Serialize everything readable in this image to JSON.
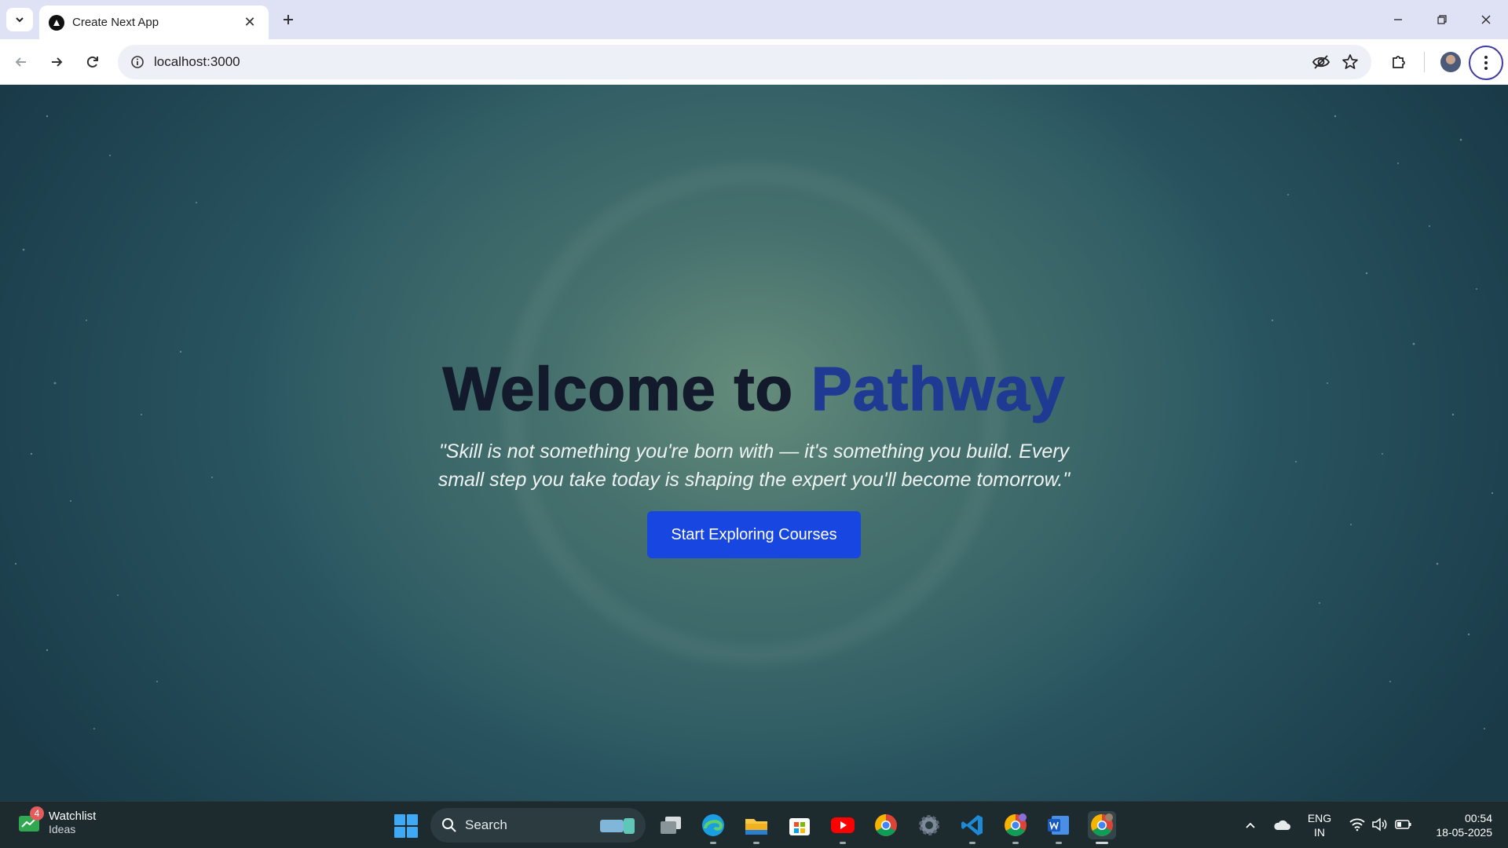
{
  "browser": {
    "tab": {
      "title": "Create Next App"
    },
    "address": {
      "url": "localhost:3000"
    }
  },
  "hero": {
    "title_part1": "Welcome to ",
    "title_part2": "Pathway",
    "quote_line1": "\"Skill is not something you're born with — it's something you build. Every",
    "quote_line2": "small step you take today is shaping the expert you'll become tomorrow.\"",
    "cta_label": "Start Exploring Courses"
  },
  "taskbar": {
    "widget": {
      "title": "Watchlist",
      "subtitle": "Ideas",
      "badge": "4"
    },
    "search_label": "Search",
    "lang_line1": "ENG",
    "lang_line2": "IN",
    "time": "00:54",
    "date": "18-05-2025",
    "apps": [
      "task-view",
      "edge",
      "file-explorer",
      "store",
      "youtube",
      "chrome",
      "settings",
      "vscode",
      "chrome-profile",
      "word",
      "chrome-active"
    ]
  },
  "colors": {
    "accent_title": "#1f3a93",
    "title_dark": "#121a2c",
    "cta_bg": "#1846e0"
  }
}
